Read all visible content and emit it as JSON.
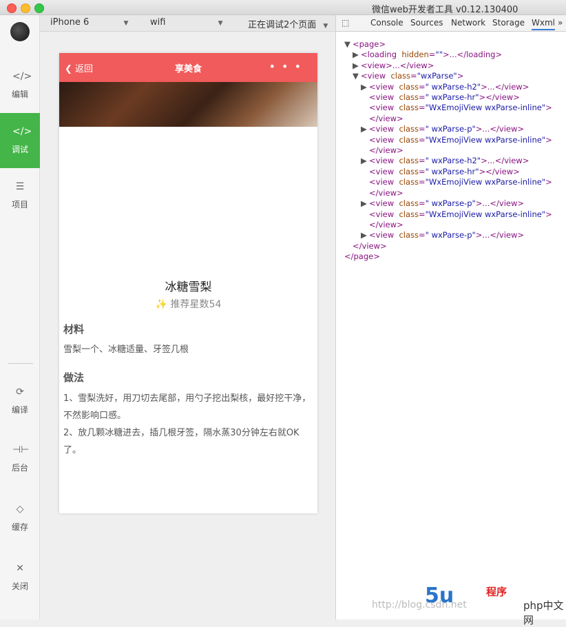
{
  "window": {
    "title": "微信web开发者工具 v0.12.130400"
  },
  "sidebar": {
    "items": [
      {
        "label": "编辑",
        "icon": "code-icon"
      },
      {
        "label": "调试",
        "icon": "debug-icon",
        "active": true
      },
      {
        "label": "项目",
        "icon": "menu-icon"
      },
      {
        "label": "编译",
        "icon": "compile-icon"
      },
      {
        "label": "后台",
        "icon": "background-icon"
      },
      {
        "label": "缓存",
        "icon": "layers-icon"
      },
      {
        "label": "关闭",
        "icon": "close-icon"
      }
    ],
    "accent": "#44b549"
  },
  "toolbar": {
    "device": "iPhone 6",
    "network": "wifi",
    "debug_pages": "正在调试2个页面"
  },
  "phone": {
    "nav": {
      "back": "返回",
      "title": "享美食",
      "more": "• • •",
      "color": "#f15b5b"
    },
    "dish_name": "冰糖雪梨",
    "rating": "推荐星数54",
    "sections": [
      {
        "heading": "材料",
        "text": "雪梨一个、冰糖适量、牙签几根"
      },
      {
        "heading": "做法",
        "text": "1、雪梨洗好，用刀切去尾部，用勺子挖出梨核，最好挖干净，不然影响口感。",
        "text2": "2、放几颗冰糖进去，插几根牙签，隔水蒸30分钟左右就OK了。"
      }
    ]
  },
  "devtools": {
    "tabs": [
      "Console",
      "Sources",
      "Network",
      "Storage",
      "Wxml"
    ],
    "active_tab": "Wxml",
    "more": "»"
  },
  "watermark": {
    "url": "http://blog.csdn.net",
    "logo": "5u",
    "logo_text": "程序",
    "site": "php中文网"
  }
}
